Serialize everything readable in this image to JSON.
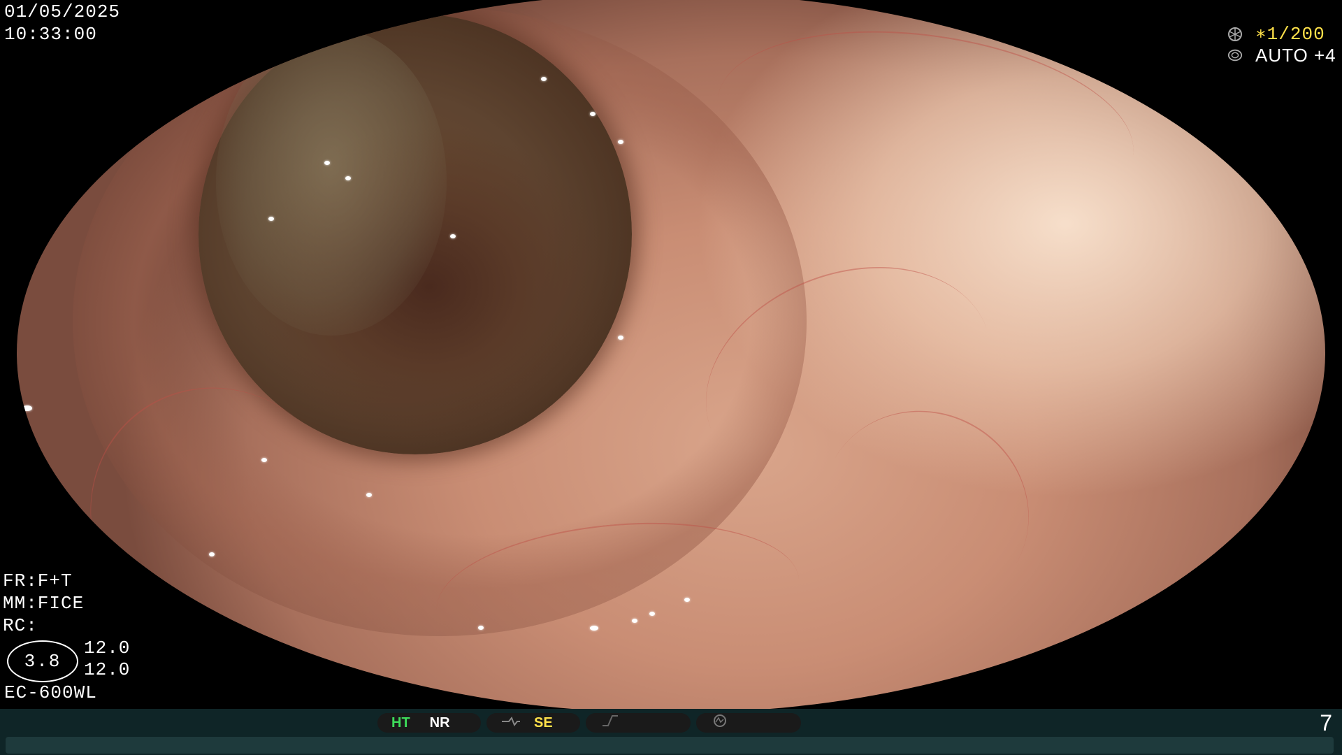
{
  "datetime": {
    "date": "01/05/2025",
    "time": "10:33:00"
  },
  "exposure": {
    "shutter_icon": "shutter-icon",
    "shutter": "∗1/200",
    "iris_icon": "iris-icon",
    "iris": "AUTO +4"
  },
  "settings": {
    "fr": "FR:F+T",
    "mm": "MM:FICE",
    "rc": "RC:",
    "ratio": "3.8",
    "value_1": "12.0",
    "value_2": "12.0",
    "scope_model": "EC-600WL"
  },
  "status_bar": {
    "ht": "HT",
    "nr": "NR",
    "se_icon": "structure-enhancement-icon",
    "se": "SE",
    "color_icon": "color-enhancement-icon",
    "mode_icon": "mode-icon",
    "page_number": "7"
  },
  "colors": {
    "yellow_accent": "#ffe14a",
    "green_active": "#3ddc5a",
    "bar_background": "#0f2527"
  }
}
